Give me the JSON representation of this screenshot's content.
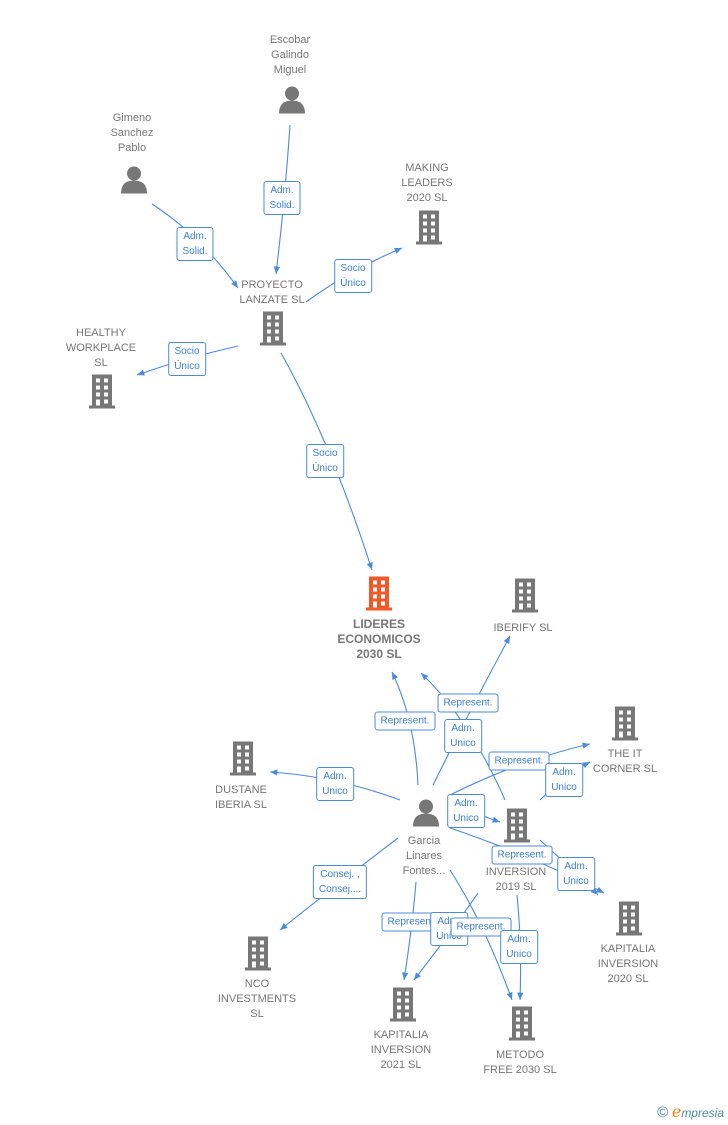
{
  "colors": {
    "edge": "#4a8be0",
    "building": "#777777",
    "focus_building": "#f05a28",
    "text": "#777777"
  },
  "nodes": [
    {
      "id": "escobar",
      "type": "person",
      "label": "Escobar\nGalindo\nMiguel"
    },
    {
      "id": "gimeno",
      "type": "person",
      "label": "Gimeno\nSanchez\nPablo"
    },
    {
      "id": "making",
      "type": "company",
      "label": "MAKING\nLEADERS\n2020  SL"
    },
    {
      "id": "proyecto",
      "type": "company",
      "label": "PROYECTO\nLANZATE SL"
    },
    {
      "id": "healthy",
      "type": "company",
      "label": "HEALTHY\nWORKPLACE\nSL"
    },
    {
      "id": "lideres",
      "type": "company",
      "focus": true,
      "label": "LIDERES\nECONOMICOS\n2030  SL"
    },
    {
      "id": "iberify",
      "type": "company",
      "label": "IBERIFY  SL"
    },
    {
      "id": "itcorner",
      "type": "company",
      "label": "THE IT\nCORNER  SL"
    },
    {
      "id": "dustane",
      "type": "company",
      "label": "DUSTANE\nIBERIA  SL"
    },
    {
      "id": "garcia",
      "type": "person",
      "label": "Garcia\nLinares\nFontes..."
    },
    {
      "id": "inversion2019",
      "type": "company",
      "label": "INVERSION\n2019  SL"
    },
    {
      "id": "kapitalia2020",
      "type": "company",
      "label": "KAPITALIA\nINVERSION\n2020  SL"
    },
    {
      "id": "nco",
      "type": "company",
      "label": "NCO\nINVESTMENTS\nSL"
    },
    {
      "id": "kapitalia2021",
      "type": "company",
      "label": "KAPITALIA\nINVERSION\n2021  SL"
    },
    {
      "id": "metodo",
      "type": "company",
      "label": "METODO\nFREE 2030  SL"
    }
  ],
  "edges": [
    {
      "from": "escobar",
      "to": "proyecto",
      "label": "Adm.\nSolid."
    },
    {
      "from": "gimeno",
      "to": "proyecto",
      "label": "Adm.\nSolid."
    },
    {
      "from": "proyecto",
      "to": "making",
      "label": "Socio\nÚnico"
    },
    {
      "from": "proyecto",
      "to": "healthy",
      "label": "Socio\nÚnico"
    },
    {
      "from": "proyecto",
      "to": "lideres",
      "label": "Socio\nÚnico"
    },
    {
      "from": "garcia",
      "to": "lideres",
      "label": "Represent."
    },
    {
      "from": "inversion2019",
      "to": "lideres",
      "label": "Represent."
    },
    {
      "from": "garcia",
      "to": "iberify",
      "label": "Adm.\nUnico"
    },
    {
      "from": "garcia",
      "to": "itcorner",
      "label": "Represent."
    },
    {
      "from": "inversion2019",
      "to": "itcorner",
      "label": "Adm.\nUnico"
    },
    {
      "from": "garcia",
      "to": "dustane",
      "label": "Adm.\nUnico"
    },
    {
      "from": "garcia",
      "to": "inversion2019",
      "label": "Adm.\nUnico"
    },
    {
      "from": "garcia",
      "to": "kapitalia2020",
      "label": "Represent."
    },
    {
      "from": "inversion2019",
      "to": "kapitalia2020",
      "label": "Adm.\nUnico"
    },
    {
      "from": "garcia",
      "to": "nco",
      "label": "Consej. ,\nConsej...."
    },
    {
      "from": "garcia",
      "to": "kapitalia2021",
      "label": "Represent."
    },
    {
      "from": "inversion2019",
      "to": "kapitalia2021",
      "label": "Adm.\nUnico"
    },
    {
      "from": "garcia",
      "to": "metodo",
      "label": "Represent."
    },
    {
      "from": "inversion2019",
      "to": "metodo",
      "label": "Adm.\nUnico"
    }
  ],
  "footer": {
    "copyright": "©",
    "brand_initial": "e",
    "brand_rest": "mpresia"
  }
}
